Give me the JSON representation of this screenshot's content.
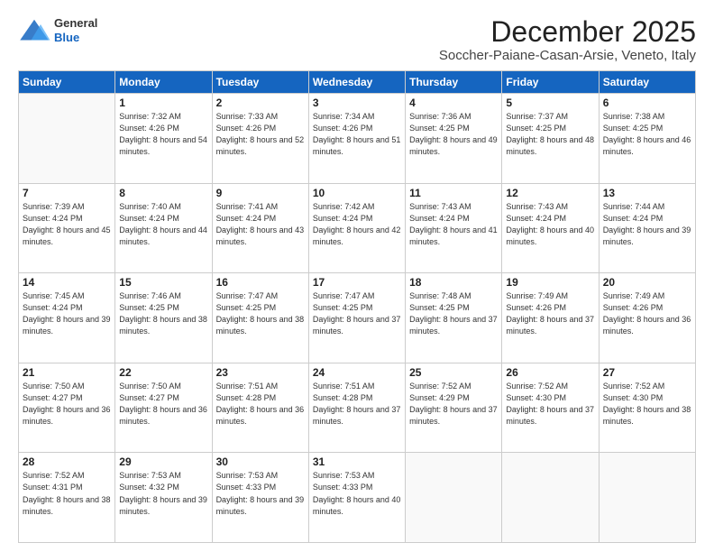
{
  "header": {
    "logo": {
      "line1": "General",
      "line2": "Blue"
    },
    "month": "December 2025",
    "location": "Soccher-Paiane-Casan-Arsie, Veneto, Italy"
  },
  "weekdays": [
    "Sunday",
    "Monday",
    "Tuesday",
    "Wednesday",
    "Thursday",
    "Friday",
    "Saturday"
  ],
  "weeks": [
    [
      {
        "day": "",
        "sunrise": "",
        "sunset": "",
        "daylight": ""
      },
      {
        "day": "1",
        "sunrise": "Sunrise: 7:32 AM",
        "sunset": "Sunset: 4:26 PM",
        "daylight": "Daylight: 8 hours and 54 minutes."
      },
      {
        "day": "2",
        "sunrise": "Sunrise: 7:33 AM",
        "sunset": "Sunset: 4:26 PM",
        "daylight": "Daylight: 8 hours and 52 minutes."
      },
      {
        "day": "3",
        "sunrise": "Sunrise: 7:34 AM",
        "sunset": "Sunset: 4:26 PM",
        "daylight": "Daylight: 8 hours and 51 minutes."
      },
      {
        "day": "4",
        "sunrise": "Sunrise: 7:36 AM",
        "sunset": "Sunset: 4:25 PM",
        "daylight": "Daylight: 8 hours and 49 minutes."
      },
      {
        "day": "5",
        "sunrise": "Sunrise: 7:37 AM",
        "sunset": "Sunset: 4:25 PM",
        "daylight": "Daylight: 8 hours and 48 minutes."
      },
      {
        "day": "6",
        "sunrise": "Sunrise: 7:38 AM",
        "sunset": "Sunset: 4:25 PM",
        "daylight": "Daylight: 8 hours and 46 minutes."
      }
    ],
    [
      {
        "day": "7",
        "sunrise": "Sunrise: 7:39 AM",
        "sunset": "Sunset: 4:24 PM",
        "daylight": "Daylight: 8 hours and 45 minutes."
      },
      {
        "day": "8",
        "sunrise": "Sunrise: 7:40 AM",
        "sunset": "Sunset: 4:24 PM",
        "daylight": "Daylight: 8 hours and 44 minutes."
      },
      {
        "day": "9",
        "sunrise": "Sunrise: 7:41 AM",
        "sunset": "Sunset: 4:24 PM",
        "daylight": "Daylight: 8 hours and 43 minutes."
      },
      {
        "day": "10",
        "sunrise": "Sunrise: 7:42 AM",
        "sunset": "Sunset: 4:24 PM",
        "daylight": "Daylight: 8 hours and 42 minutes."
      },
      {
        "day": "11",
        "sunrise": "Sunrise: 7:43 AM",
        "sunset": "Sunset: 4:24 PM",
        "daylight": "Daylight: 8 hours and 41 minutes."
      },
      {
        "day": "12",
        "sunrise": "Sunrise: 7:43 AM",
        "sunset": "Sunset: 4:24 PM",
        "daylight": "Daylight: 8 hours and 40 minutes."
      },
      {
        "day": "13",
        "sunrise": "Sunrise: 7:44 AM",
        "sunset": "Sunset: 4:24 PM",
        "daylight": "Daylight: 8 hours and 39 minutes."
      }
    ],
    [
      {
        "day": "14",
        "sunrise": "Sunrise: 7:45 AM",
        "sunset": "Sunset: 4:24 PM",
        "daylight": "Daylight: 8 hours and 39 minutes."
      },
      {
        "day": "15",
        "sunrise": "Sunrise: 7:46 AM",
        "sunset": "Sunset: 4:25 PM",
        "daylight": "Daylight: 8 hours and 38 minutes."
      },
      {
        "day": "16",
        "sunrise": "Sunrise: 7:47 AM",
        "sunset": "Sunset: 4:25 PM",
        "daylight": "Daylight: 8 hours and 38 minutes."
      },
      {
        "day": "17",
        "sunrise": "Sunrise: 7:47 AM",
        "sunset": "Sunset: 4:25 PM",
        "daylight": "Daylight: 8 hours and 37 minutes."
      },
      {
        "day": "18",
        "sunrise": "Sunrise: 7:48 AM",
        "sunset": "Sunset: 4:25 PM",
        "daylight": "Daylight: 8 hours and 37 minutes."
      },
      {
        "day": "19",
        "sunrise": "Sunrise: 7:49 AM",
        "sunset": "Sunset: 4:26 PM",
        "daylight": "Daylight: 8 hours and 37 minutes."
      },
      {
        "day": "20",
        "sunrise": "Sunrise: 7:49 AM",
        "sunset": "Sunset: 4:26 PM",
        "daylight": "Daylight: 8 hours and 36 minutes."
      }
    ],
    [
      {
        "day": "21",
        "sunrise": "Sunrise: 7:50 AM",
        "sunset": "Sunset: 4:27 PM",
        "daylight": "Daylight: 8 hours and 36 minutes."
      },
      {
        "day": "22",
        "sunrise": "Sunrise: 7:50 AM",
        "sunset": "Sunset: 4:27 PM",
        "daylight": "Daylight: 8 hours and 36 minutes."
      },
      {
        "day": "23",
        "sunrise": "Sunrise: 7:51 AM",
        "sunset": "Sunset: 4:28 PM",
        "daylight": "Daylight: 8 hours and 36 minutes."
      },
      {
        "day": "24",
        "sunrise": "Sunrise: 7:51 AM",
        "sunset": "Sunset: 4:28 PM",
        "daylight": "Daylight: 8 hours and 37 minutes."
      },
      {
        "day": "25",
        "sunrise": "Sunrise: 7:52 AM",
        "sunset": "Sunset: 4:29 PM",
        "daylight": "Daylight: 8 hours and 37 minutes."
      },
      {
        "day": "26",
        "sunrise": "Sunrise: 7:52 AM",
        "sunset": "Sunset: 4:30 PM",
        "daylight": "Daylight: 8 hours and 37 minutes."
      },
      {
        "day": "27",
        "sunrise": "Sunrise: 7:52 AM",
        "sunset": "Sunset: 4:30 PM",
        "daylight": "Daylight: 8 hours and 38 minutes."
      }
    ],
    [
      {
        "day": "28",
        "sunrise": "Sunrise: 7:52 AM",
        "sunset": "Sunset: 4:31 PM",
        "daylight": "Daylight: 8 hours and 38 minutes."
      },
      {
        "day": "29",
        "sunrise": "Sunrise: 7:53 AM",
        "sunset": "Sunset: 4:32 PM",
        "daylight": "Daylight: 8 hours and 39 minutes."
      },
      {
        "day": "30",
        "sunrise": "Sunrise: 7:53 AM",
        "sunset": "Sunset: 4:33 PM",
        "daylight": "Daylight: 8 hours and 39 minutes."
      },
      {
        "day": "31",
        "sunrise": "Sunrise: 7:53 AM",
        "sunset": "Sunset: 4:33 PM",
        "daylight": "Daylight: 8 hours and 40 minutes."
      },
      {
        "day": "",
        "sunrise": "",
        "sunset": "",
        "daylight": ""
      },
      {
        "day": "",
        "sunrise": "",
        "sunset": "",
        "daylight": ""
      },
      {
        "day": "",
        "sunrise": "",
        "sunset": "",
        "daylight": ""
      }
    ]
  ]
}
